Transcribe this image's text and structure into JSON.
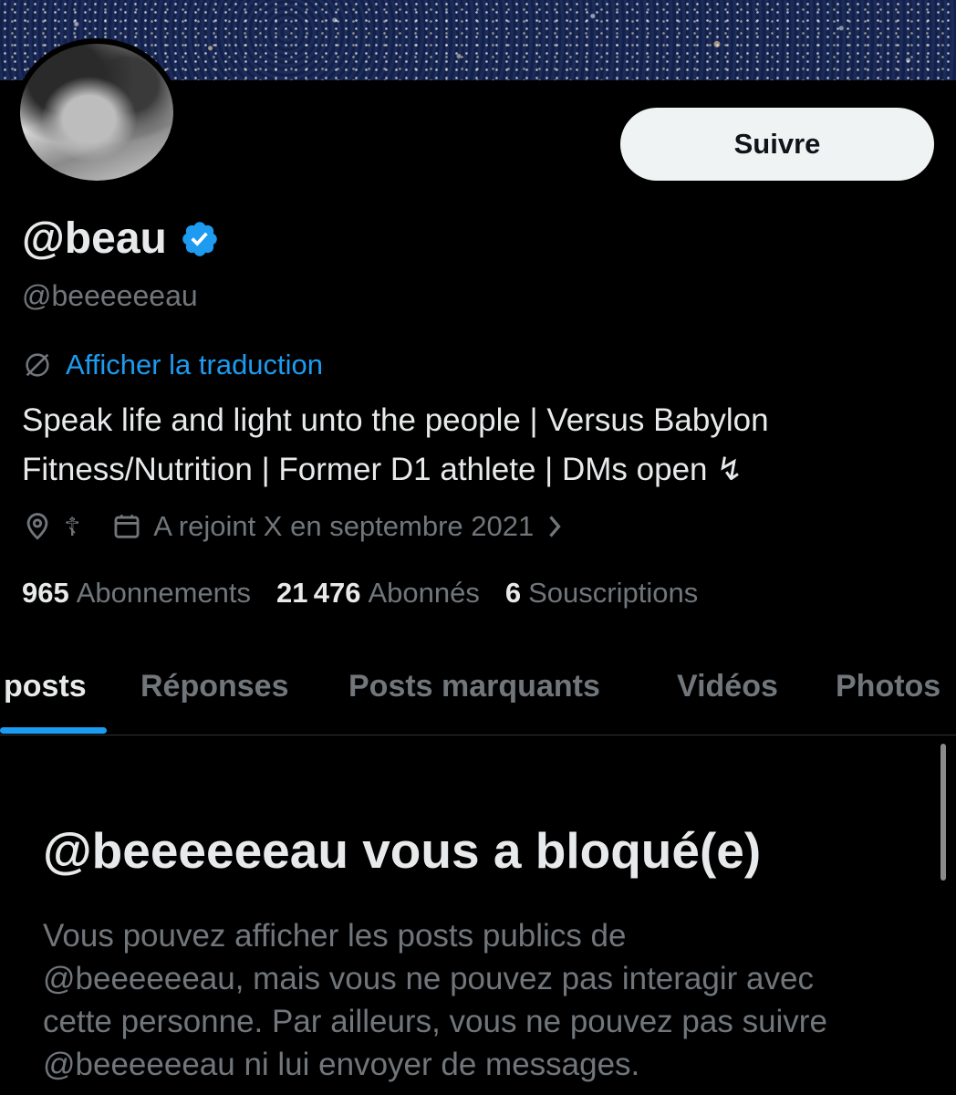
{
  "profile": {
    "display_name": "@beau",
    "handle": "@beeeeeeau",
    "follow_label": "Suivre",
    "translate_label": "Afficher la traduction",
    "bio_lines": [
      "Speak life and light unto the people | Versus Babylon",
      "Fitness/Nutrition | Former D1 athlete | DMs open ↯"
    ],
    "location": "☦",
    "joined": "A rejoint X en septembre 2021",
    "stats": [
      {
        "value": "965",
        "label": "Abonnements"
      },
      {
        "value": "21 476",
        "label": "Abonnés"
      },
      {
        "value": "6",
        "label": "Souscriptions"
      }
    ]
  },
  "tabs": [
    {
      "label": "posts",
      "active": true
    },
    {
      "label": "Réponses",
      "active": false
    },
    {
      "label": "Posts marquants",
      "active": false
    },
    {
      "label": "Vidéos",
      "active": false
    },
    {
      "label": "Photos",
      "active": false
    }
  ],
  "blocked": {
    "title": "@beeeeeeau vous a bloqué(e)",
    "description_lines": [
      "Vous pouvez afficher les posts publics de",
      "@beeeeeeau, mais vous ne pouvez pas interagir avec",
      "cette personne. Par ailleurs, vous ne pouvez pas suivre",
      "@beeeeeeau ni lui envoyer de messages."
    ]
  },
  "colors": {
    "background": "#000000",
    "accent": "#1d9bf0",
    "secondary_text": "#71767b",
    "primary_text": "#e7e9ea"
  },
  "icons": {
    "verified": "verified-badge-icon",
    "translate": "globe-slash-icon",
    "location": "location-pin-icon",
    "calendar": "calendar-icon",
    "chevron": "chevron-right-icon"
  }
}
